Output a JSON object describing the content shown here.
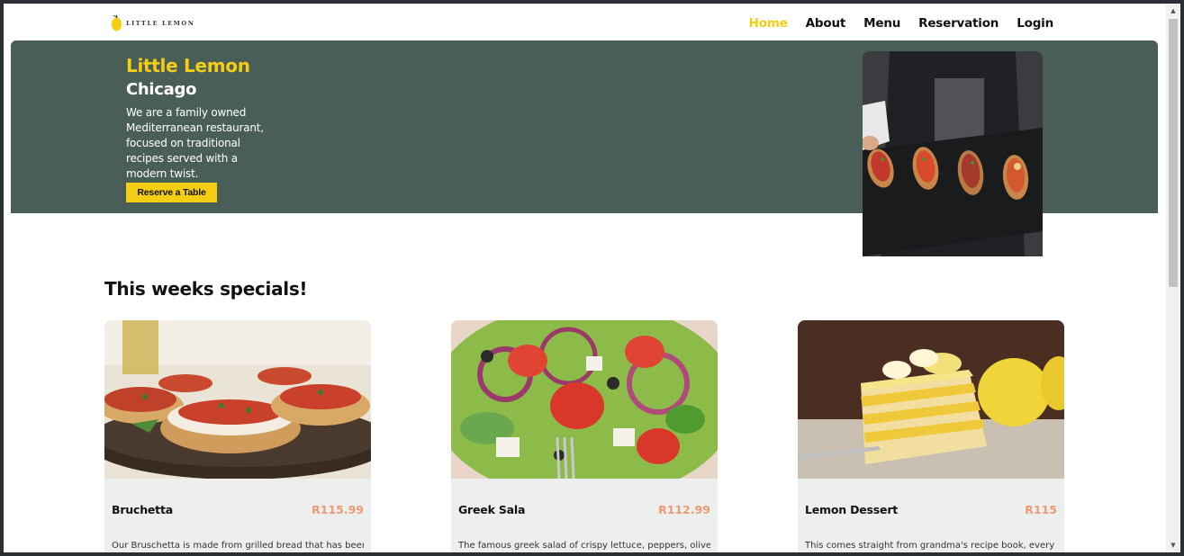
{
  "brand": {
    "logo_text": "LITTLE LEMON"
  },
  "nav": {
    "items": [
      {
        "label": "Home",
        "active": true
      },
      {
        "label": "About"
      },
      {
        "label": "Menu"
      },
      {
        "label": "Reservation"
      },
      {
        "label": "Login"
      }
    ]
  },
  "hero": {
    "title": "Little Lemon",
    "city": "Chicago",
    "description": "We are a family owned Mediterranean restaurant, focused on traditional recipes served with a modern twist.",
    "button_label": "Reserve a Table"
  },
  "specials": {
    "heading": "This weeks specials!",
    "cards": [
      {
        "name": "Bruchetta",
        "price": "R115.99",
        "description": "Our Bruschetta is made from grilled bread that has been"
      },
      {
        "name": "Greek Sala",
        "price": "R112.99",
        "description": "The famous greek salad of crispy lettuce, peppers, olives"
      },
      {
        "name": "Lemon Dessert",
        "price": "R115",
        "description": "This comes straight from grandma's recipe book, every last"
      }
    ]
  },
  "colors": {
    "primary_green": "#495e57",
    "primary_yellow": "#f4ce14",
    "price_salmon": "#ee9972",
    "card_bg": "#edefee"
  }
}
